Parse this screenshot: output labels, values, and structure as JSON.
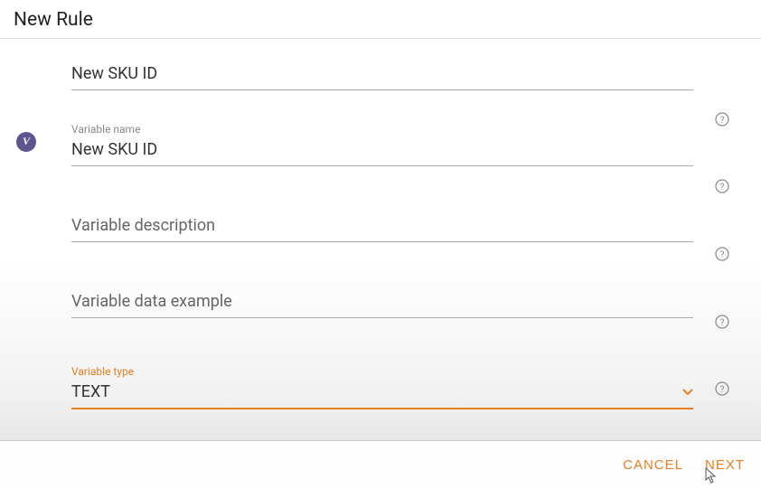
{
  "header": {
    "title": "New Rule"
  },
  "fields": {
    "field1": {
      "value": "New SKU ID"
    },
    "variable_name": {
      "label": "Variable name",
      "value": "New SKU ID"
    },
    "variable_description": {
      "placeholder": "Variable description"
    },
    "variable_example": {
      "placeholder": "Variable data example"
    },
    "variable_type": {
      "label": "Variable type",
      "value": "TEXT"
    }
  },
  "footer": {
    "cancel": "CANCEL",
    "next": "NEXT"
  },
  "help_offsets": {
    "h1": "76px",
    "h2": "150px",
    "h3": "225px",
    "h4": "300px",
    "h5": "374px"
  }
}
